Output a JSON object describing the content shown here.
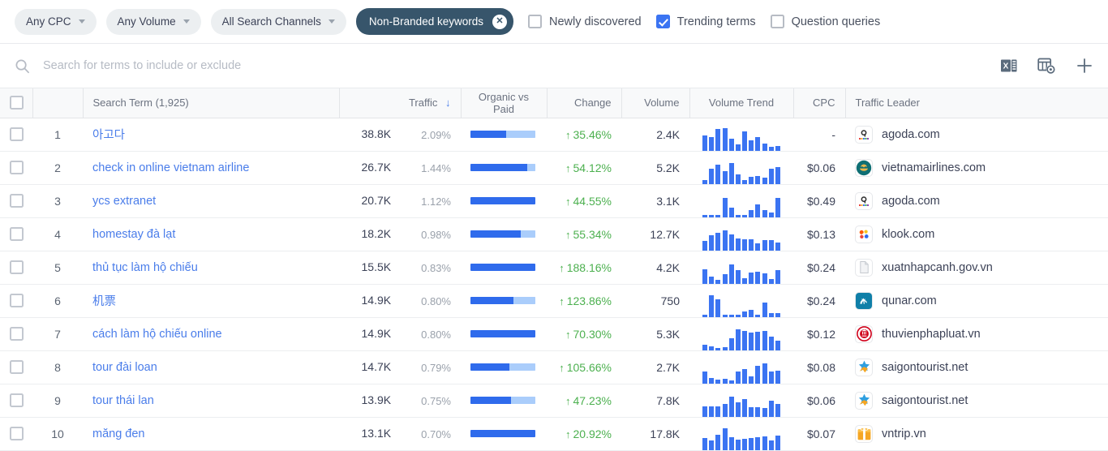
{
  "filters": {
    "cpc": "Any CPC",
    "volume": "Any Volume",
    "channels": "All Search Channels",
    "active_chip": "Non-Branded keywords",
    "active_chip_close": "✕",
    "checkboxes": [
      {
        "label": "Newly discovered",
        "checked": false
      },
      {
        "label": "Trending terms",
        "checked": true
      },
      {
        "label": "Question queries",
        "checked": false
      }
    ]
  },
  "search": {
    "placeholder": "Search for terms to include or exclude",
    "value": "",
    "icons": [
      "search-icon",
      "excel-export-icon",
      "table-settings-icon",
      "add-column-icon"
    ]
  },
  "table": {
    "columns": [
      {
        "key": "checkbox",
        "label": ""
      },
      {
        "key": "index",
        "label": ""
      },
      {
        "key": "term",
        "label": "Search Term (1,925)"
      },
      {
        "key": "traffic",
        "label": "Traffic",
        "sorted": "desc",
        "sort_glyph": "↓"
      },
      {
        "key": "organic_vs_paid",
        "label": "Organic vs Paid"
      },
      {
        "key": "change",
        "label": "Change"
      },
      {
        "key": "volume",
        "label": "Volume"
      },
      {
        "key": "volume_trend",
        "label": "Volume Trend"
      },
      {
        "key": "cpc",
        "label": "CPC"
      },
      {
        "key": "leader",
        "label": "Traffic Leader"
      }
    ],
    "rows": [
      {
        "index": "1",
        "term": "아고다",
        "traffic": "38.8K",
        "traffic_pct": "2.09%",
        "pct_fill": 9,
        "organic": 55,
        "paid": 45,
        "change": "35.46%",
        "change_dir": "↑",
        "volume": "2.4K",
        "trend": [
          62,
          55,
          88,
          92,
          48,
          25,
          78,
          42,
          55,
          28,
          14,
          17
        ],
        "cpc": "-",
        "domain": "agoda.com",
        "favicon": "agoda-icon"
      },
      {
        "index": "2",
        "term": "check in online vietnam airline",
        "traffic": "26.7K",
        "traffic_pct": "1.44%",
        "pct_fill": 7,
        "organic": 87,
        "paid": 13,
        "change": "54.12%",
        "change_dir": "↑",
        "volume": "5.2K",
        "trend": [
          15,
          62,
          80,
          52,
          84,
          40,
          14,
          28,
          32,
          25,
          62,
          70
        ],
        "cpc": "$0.06",
        "domain": "vietnamairlines.com",
        "favicon": "vietnamairlines-icon"
      },
      {
        "index": "3",
        "term": "ycs extranet",
        "traffic": "20.7K",
        "traffic_pct": "1.12%",
        "pct_fill": 6,
        "organic": 100,
        "paid": 0,
        "change": "44.55%",
        "change_dir": "↑",
        "volume": "3.1K",
        "trend": [
          8,
          8,
          8,
          78,
          38,
          9,
          10,
          28,
          52,
          30,
          18,
          80
        ],
        "cpc": "$0.49",
        "domain": "agoda.com",
        "favicon": "agoda-icon"
      },
      {
        "index": "4",
        "term": "homestay đà lạt",
        "traffic": "18.2K",
        "traffic_pct": "0.98%",
        "pct_fill": 6,
        "organic": 78,
        "paid": 22,
        "change": "55.34%",
        "change_dir": "↑",
        "volume": "12.7K",
        "trend": [
          40,
          62,
          72,
          82,
          65,
          48,
          45,
          45,
          28,
          42,
          42,
          32
        ],
        "cpc": "$0.13",
        "domain": "klook.com",
        "favicon": "klook-icon"
      },
      {
        "index": "5",
        "term": "thủ tục làm hộ chiếu",
        "traffic": "15.5K",
        "traffic_pct": "0.83%",
        "pct_fill": 5,
        "organic": 100,
        "paid": 0,
        "change": "188.16%",
        "change_dir": "↑",
        "volume": "4.2K",
        "trend": [
          58,
          30,
          15,
          38,
          78,
          55,
          22,
          45,
          48,
          42,
          20,
          55
        ],
        "cpc": "$0.24",
        "domain": "xuatnhapcanh.gov.vn",
        "favicon": "document-icon"
      },
      {
        "index": "6",
        "term": "机票",
        "traffic": "14.9K",
        "traffic_pct": "0.80%",
        "pct_fill": 5,
        "organic": 66,
        "paid": 34,
        "change": "123.86%",
        "change_dir": "↑",
        "volume": "750",
        "trend": [
          10,
          88,
          72,
          10,
          9,
          9,
          22,
          28,
          9,
          58,
          14,
          14
        ],
        "cpc": "$0.24",
        "domain": "qunar.com",
        "favicon": "qunar-icon"
      },
      {
        "index": "7",
        "term": "cách làm hộ chiếu online",
        "traffic": "14.9K",
        "traffic_pct": "0.80%",
        "pct_fill": 5,
        "organic": 100,
        "paid": 0,
        "change": "70.30%",
        "change_dir": "↑",
        "volume": "5.3K",
        "trend": [
          22,
          14,
          9,
          12,
          48,
          84,
          78,
          72,
          76,
          80,
          55,
          38
        ],
        "cpc": "$0.12",
        "domain": "thuvienphapluat.vn",
        "favicon": "thuvienphapluat-icon"
      },
      {
        "index": "8",
        "term": "tour đài loan",
        "traffic": "14.7K",
        "traffic_pct": "0.79%",
        "pct_fill": 5,
        "organic": 60,
        "paid": 40,
        "change": "105.66%",
        "change_dir": "↑",
        "volume": "2.7K",
        "trend": [
          50,
          22,
          16,
          18,
          12,
          48,
          60,
          30,
          72,
          82,
          48,
          52
        ],
        "cpc": "$0.08",
        "domain": "saigontourist.net",
        "favicon": "saigontourist-icon"
      },
      {
        "index": "9",
        "term": "tour thái lan",
        "traffic": "13.9K",
        "traffic_pct": "0.75%",
        "pct_fill": 5,
        "organic": 62,
        "paid": 38,
        "change": "47.23%",
        "change_dir": "↑",
        "volume": "7.8K",
        "trend": [
          42,
          42,
          42,
          52,
          82,
          58,
          72,
          38,
          38,
          36,
          66,
          52
        ],
        "cpc": "$0.06",
        "domain": "saigontourist.net",
        "favicon": "saigontourist-icon"
      },
      {
        "index": "10",
        "term": "măng đen",
        "traffic": "13.1K",
        "traffic_pct": "0.70%",
        "pct_fill": 4,
        "organic": 100,
        "paid": 0,
        "change": "20.92%",
        "change_dir": "↑",
        "volume": "17.8K",
        "trend": [
          48,
          38,
          62,
          88,
          52,
          42,
          45,
          48,
          52,
          54,
          38,
          60
        ],
        "cpc": "$0.07",
        "domain": "vntrip.vn",
        "favicon": "vntrip-icon"
      }
    ]
  },
  "colors": {
    "accent_blue": "#3b74f2",
    "link_blue": "#4a7dea",
    "chip_active": "#37556b",
    "change_green": "#4cb04f",
    "organic": "#2f6bec",
    "paid": "#aacdfb"
  }
}
